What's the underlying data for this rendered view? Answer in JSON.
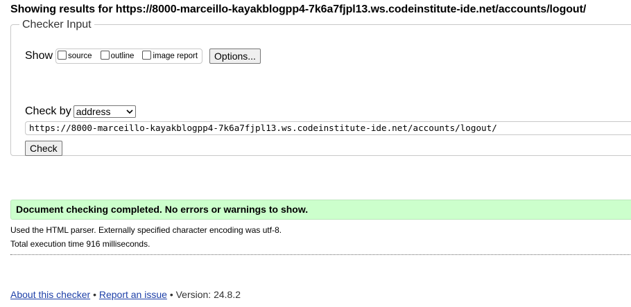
{
  "heading": "Showing results for https://8000-marceillo-kayakblogpp4-7k6a7fjpl13.ws.codeinstitute-ide.net/accounts/logout/",
  "checker": {
    "legend": "Checker Input",
    "show_label": "Show",
    "options": [
      {
        "label": "source",
        "checked": false
      },
      {
        "label": "outline",
        "checked": false
      },
      {
        "label": "image report",
        "checked": false
      }
    ],
    "options_button": "Options...",
    "check_by_label": "Check by",
    "check_by_value": "address",
    "url_value": "https://8000-marceillo-kayakblogpp4-7k6a7fjpl13.ws.codeinstitute-ide.net/accounts/logout/",
    "check_button": "Check"
  },
  "result": {
    "success_message": "Document checking completed. No errors or warnings to show.",
    "parser_info": "Used the HTML parser. Externally specified character encoding was utf-8.",
    "execution_time": "Total execution time 916 milliseconds."
  },
  "footer": {
    "about_link": "About this checker",
    "separator": "•",
    "report_link": "Report an issue",
    "version": "Version: 24.8.2"
  },
  "colors": {
    "success_bg": "#ccffcc",
    "link": "#1e40a8"
  }
}
